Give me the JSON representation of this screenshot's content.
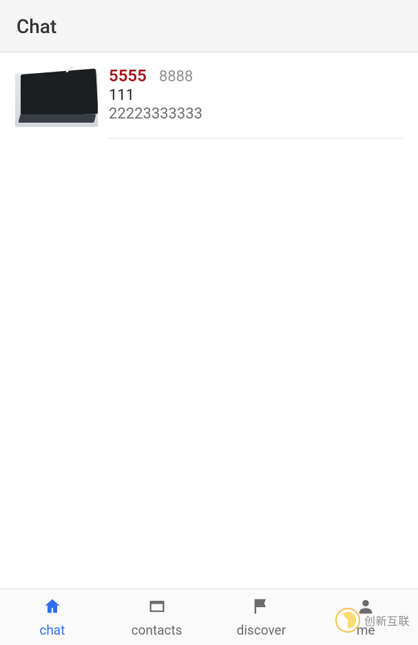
{
  "header": {
    "title": "Chat"
  },
  "list": [
    {
      "code_primary": "5555",
      "code_secondary": "8888",
      "line2": "111",
      "line3": "22223333333"
    }
  ],
  "tabs": {
    "chat": {
      "label": "chat"
    },
    "contacts": {
      "label": "contacts"
    },
    "discover": {
      "label": "discover"
    },
    "me": {
      "label": "me"
    }
  },
  "watermark": {
    "text": "创新互联"
  }
}
